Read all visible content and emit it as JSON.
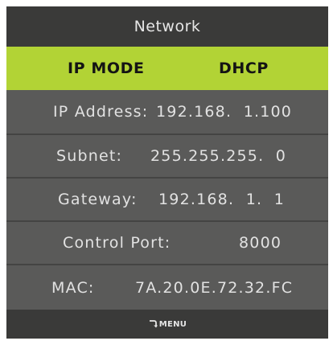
{
  "header": {
    "title": "Network"
  },
  "settings": {
    "ip_mode": {
      "label": "IP MODE",
      "value": "DHCP"
    },
    "ip_address": {
      "label": "IP Address:",
      "value": "192.168.  1.100"
    },
    "subnet": {
      "label": "Subnet:",
      "value": "255.255.255.  0"
    },
    "gateway": {
      "label": "Gateway:",
      "value": "192.168.  1.  1"
    },
    "control_port": {
      "label": "Control Port:",
      "value": "8000"
    },
    "mac": {
      "label": "MAC:",
      "value": "7A.20.0E.72.32.FC"
    }
  },
  "footer": {
    "icon": "return-arrow-icon",
    "menu_label": "MENU"
  },
  "colors": {
    "panel_background": "#5a5a59",
    "bar_background": "#3a3a39",
    "selection_highlight": "#b2d335",
    "text": "#e2e2e2"
  }
}
